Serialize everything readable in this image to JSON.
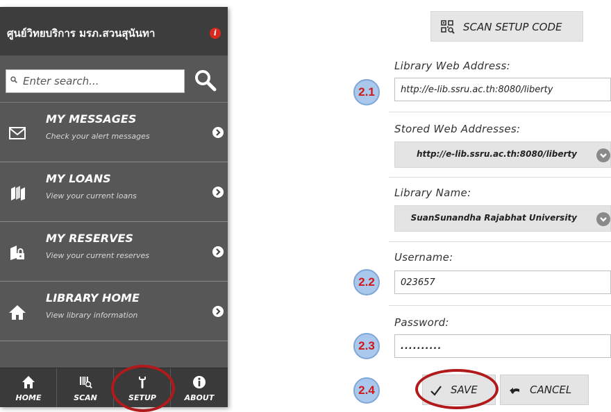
{
  "left_app": {
    "title": "ศูนย์วิทยบริการ มรภ.สวนสุนันทา",
    "search": {
      "placeholder": "Enter search..."
    },
    "menu": [
      {
        "title": "MY MESSAGES",
        "subtitle": "Check your alert messages",
        "icon": "envelope-icon"
      },
      {
        "title": "MY LOANS",
        "subtitle": "View your current loans",
        "icon": "books-icon"
      },
      {
        "title": "MY RESERVES",
        "subtitle": "View your current reserves",
        "icon": "book-lock-icon"
      },
      {
        "title": "LIBRARY HOME",
        "subtitle": "View library information",
        "icon": "home-icon"
      }
    ],
    "nav": [
      {
        "label": "HOME",
        "icon": "home-icon"
      },
      {
        "label": "SCAN",
        "icon": "barcode-scan-icon"
      },
      {
        "label": "SETUP",
        "icon": "wrench-icon"
      },
      {
        "label": "ABOUT",
        "icon": "info-icon"
      }
    ]
  },
  "setup": {
    "scan_button": "SCAN SETUP CODE",
    "web_address_label": "Library Web Address:",
    "web_address_value": "http://e-lib.ssru.ac.th:8080/liberty",
    "stored_label": "Stored Web Addresses:",
    "stored_value": "http://e-lib.ssru.ac.th:8080/liberty",
    "library_name_label": "Library Name:",
    "library_name_value": "SuanSunandha Rajabhat University",
    "username_label": "Username:",
    "username_value": "023657",
    "password_label": "Password:",
    "password_value": "..........",
    "save_label": "SAVE",
    "cancel_label": "CANCEL"
  },
  "annotations": {
    "step_1": "2.1",
    "step_2": "2.2",
    "step_3": "2.3",
    "step_4": "2.4"
  },
  "colors": {
    "header_bg": "#3d3d3d",
    "menu_bg": "#575757",
    "alert_red": "#d62a1f",
    "highlight_ring": "#b01a1a",
    "badge_fill": "#a9c8ec",
    "badge_text": "#d01818"
  }
}
